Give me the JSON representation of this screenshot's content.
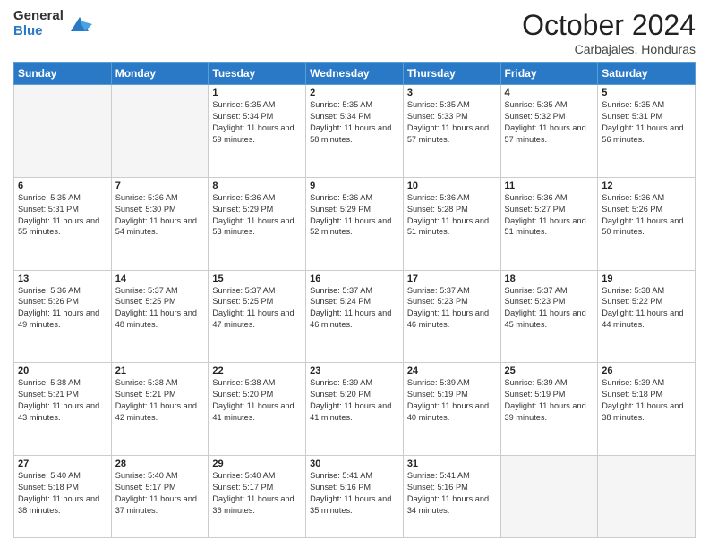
{
  "logo": {
    "general": "General",
    "blue": "Blue"
  },
  "title": "October 2024",
  "location": "Carbajales, Honduras",
  "days_of_week": [
    "Sunday",
    "Monday",
    "Tuesday",
    "Wednesday",
    "Thursday",
    "Friday",
    "Saturday"
  ],
  "weeks": [
    [
      {
        "day": "",
        "info": ""
      },
      {
        "day": "",
        "info": ""
      },
      {
        "day": "1",
        "info": "Sunrise: 5:35 AM\nSunset: 5:34 PM\nDaylight: 11 hours and 59 minutes."
      },
      {
        "day": "2",
        "info": "Sunrise: 5:35 AM\nSunset: 5:34 PM\nDaylight: 11 hours and 58 minutes."
      },
      {
        "day": "3",
        "info": "Sunrise: 5:35 AM\nSunset: 5:33 PM\nDaylight: 11 hours and 57 minutes."
      },
      {
        "day": "4",
        "info": "Sunrise: 5:35 AM\nSunset: 5:32 PM\nDaylight: 11 hours and 57 minutes."
      },
      {
        "day": "5",
        "info": "Sunrise: 5:35 AM\nSunset: 5:31 PM\nDaylight: 11 hours and 56 minutes."
      }
    ],
    [
      {
        "day": "6",
        "info": "Sunrise: 5:35 AM\nSunset: 5:31 PM\nDaylight: 11 hours and 55 minutes."
      },
      {
        "day": "7",
        "info": "Sunrise: 5:36 AM\nSunset: 5:30 PM\nDaylight: 11 hours and 54 minutes."
      },
      {
        "day": "8",
        "info": "Sunrise: 5:36 AM\nSunset: 5:29 PM\nDaylight: 11 hours and 53 minutes."
      },
      {
        "day": "9",
        "info": "Sunrise: 5:36 AM\nSunset: 5:29 PM\nDaylight: 11 hours and 52 minutes."
      },
      {
        "day": "10",
        "info": "Sunrise: 5:36 AM\nSunset: 5:28 PM\nDaylight: 11 hours and 51 minutes."
      },
      {
        "day": "11",
        "info": "Sunrise: 5:36 AM\nSunset: 5:27 PM\nDaylight: 11 hours and 51 minutes."
      },
      {
        "day": "12",
        "info": "Sunrise: 5:36 AM\nSunset: 5:26 PM\nDaylight: 11 hours and 50 minutes."
      }
    ],
    [
      {
        "day": "13",
        "info": "Sunrise: 5:36 AM\nSunset: 5:26 PM\nDaylight: 11 hours and 49 minutes."
      },
      {
        "day": "14",
        "info": "Sunrise: 5:37 AM\nSunset: 5:25 PM\nDaylight: 11 hours and 48 minutes."
      },
      {
        "day": "15",
        "info": "Sunrise: 5:37 AM\nSunset: 5:25 PM\nDaylight: 11 hours and 47 minutes."
      },
      {
        "day": "16",
        "info": "Sunrise: 5:37 AM\nSunset: 5:24 PM\nDaylight: 11 hours and 46 minutes."
      },
      {
        "day": "17",
        "info": "Sunrise: 5:37 AM\nSunset: 5:23 PM\nDaylight: 11 hours and 46 minutes."
      },
      {
        "day": "18",
        "info": "Sunrise: 5:37 AM\nSunset: 5:23 PM\nDaylight: 11 hours and 45 minutes."
      },
      {
        "day": "19",
        "info": "Sunrise: 5:38 AM\nSunset: 5:22 PM\nDaylight: 11 hours and 44 minutes."
      }
    ],
    [
      {
        "day": "20",
        "info": "Sunrise: 5:38 AM\nSunset: 5:21 PM\nDaylight: 11 hours and 43 minutes."
      },
      {
        "day": "21",
        "info": "Sunrise: 5:38 AM\nSunset: 5:21 PM\nDaylight: 11 hours and 42 minutes."
      },
      {
        "day": "22",
        "info": "Sunrise: 5:38 AM\nSunset: 5:20 PM\nDaylight: 11 hours and 41 minutes."
      },
      {
        "day": "23",
        "info": "Sunrise: 5:39 AM\nSunset: 5:20 PM\nDaylight: 11 hours and 41 minutes."
      },
      {
        "day": "24",
        "info": "Sunrise: 5:39 AM\nSunset: 5:19 PM\nDaylight: 11 hours and 40 minutes."
      },
      {
        "day": "25",
        "info": "Sunrise: 5:39 AM\nSunset: 5:19 PM\nDaylight: 11 hours and 39 minutes."
      },
      {
        "day": "26",
        "info": "Sunrise: 5:39 AM\nSunset: 5:18 PM\nDaylight: 11 hours and 38 minutes."
      }
    ],
    [
      {
        "day": "27",
        "info": "Sunrise: 5:40 AM\nSunset: 5:18 PM\nDaylight: 11 hours and 38 minutes."
      },
      {
        "day": "28",
        "info": "Sunrise: 5:40 AM\nSunset: 5:17 PM\nDaylight: 11 hours and 37 minutes."
      },
      {
        "day": "29",
        "info": "Sunrise: 5:40 AM\nSunset: 5:17 PM\nDaylight: 11 hours and 36 minutes."
      },
      {
        "day": "30",
        "info": "Sunrise: 5:41 AM\nSunset: 5:16 PM\nDaylight: 11 hours and 35 minutes."
      },
      {
        "day": "31",
        "info": "Sunrise: 5:41 AM\nSunset: 5:16 PM\nDaylight: 11 hours and 34 minutes."
      },
      {
        "day": "",
        "info": ""
      },
      {
        "day": "",
        "info": ""
      }
    ]
  ]
}
